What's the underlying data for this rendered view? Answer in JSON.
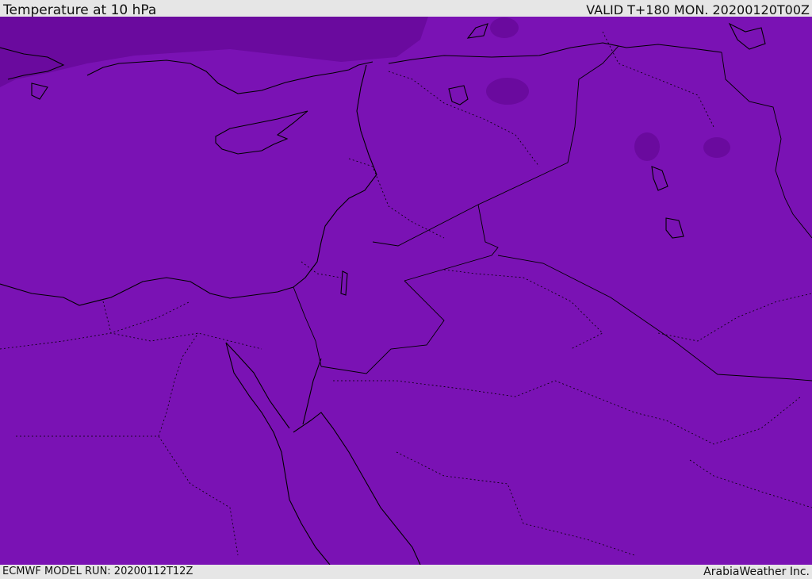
{
  "header": {
    "title": "Temperature at 10 hPa",
    "valid": "VALID T+180 MON. 20200120T00Z"
  },
  "footer": {
    "model_run": "ECMWF MODEL RUN: 20200112T12Z",
    "credit": "ArabiaWeather Inc."
  },
  "colors": {
    "field_base": "#7a12b4",
    "field_cold": "#6a0a9e",
    "coastline": "#000000",
    "frame": "#e6e6e6"
  }
}
